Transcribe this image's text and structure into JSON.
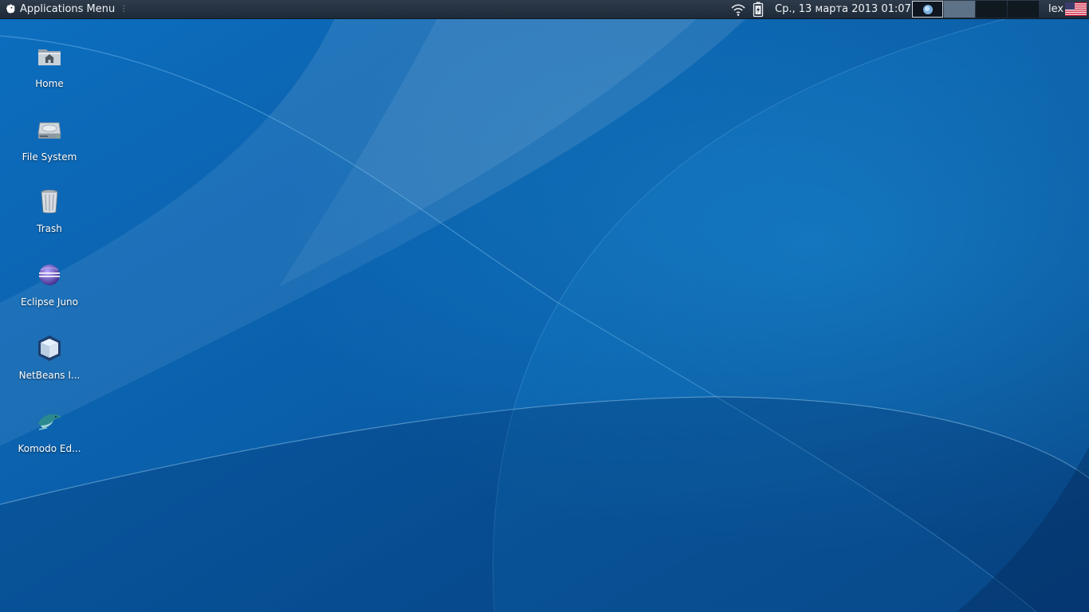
{
  "panel": {
    "app_menu_label": "Applications Menu",
    "clock": "Ср., 13 марта 2013 01:07",
    "user": "lex",
    "workspaces": [
      "Workspace 1",
      "Workspace 2",
      "Workspace 3",
      "Workspace 4"
    ],
    "active_workspace": 1,
    "keyboard_layout": "us-flag-icon",
    "colors": {
      "panel_bg": "#1e2a38",
      "panel_text": "#f0f3f6"
    }
  },
  "desktop": {
    "icons": [
      {
        "label": "Home",
        "icon": "home-folder-icon"
      },
      {
        "label": "File System",
        "icon": "hard-drive-icon"
      },
      {
        "label": "Trash",
        "icon": "trash-icon"
      },
      {
        "label": "Eclipse Juno",
        "icon": "eclipse-icon"
      },
      {
        "label": "NetBeans I...",
        "icon": "netbeans-icon"
      },
      {
        "label": "Komodo Ed...",
        "icon": "komodo-icon"
      }
    ],
    "colors": {
      "wallpaper_dark": "#053a78",
      "wallpaper_mid": "#0a5aa3",
      "wallpaper_light": "#1a8ad2"
    }
  }
}
